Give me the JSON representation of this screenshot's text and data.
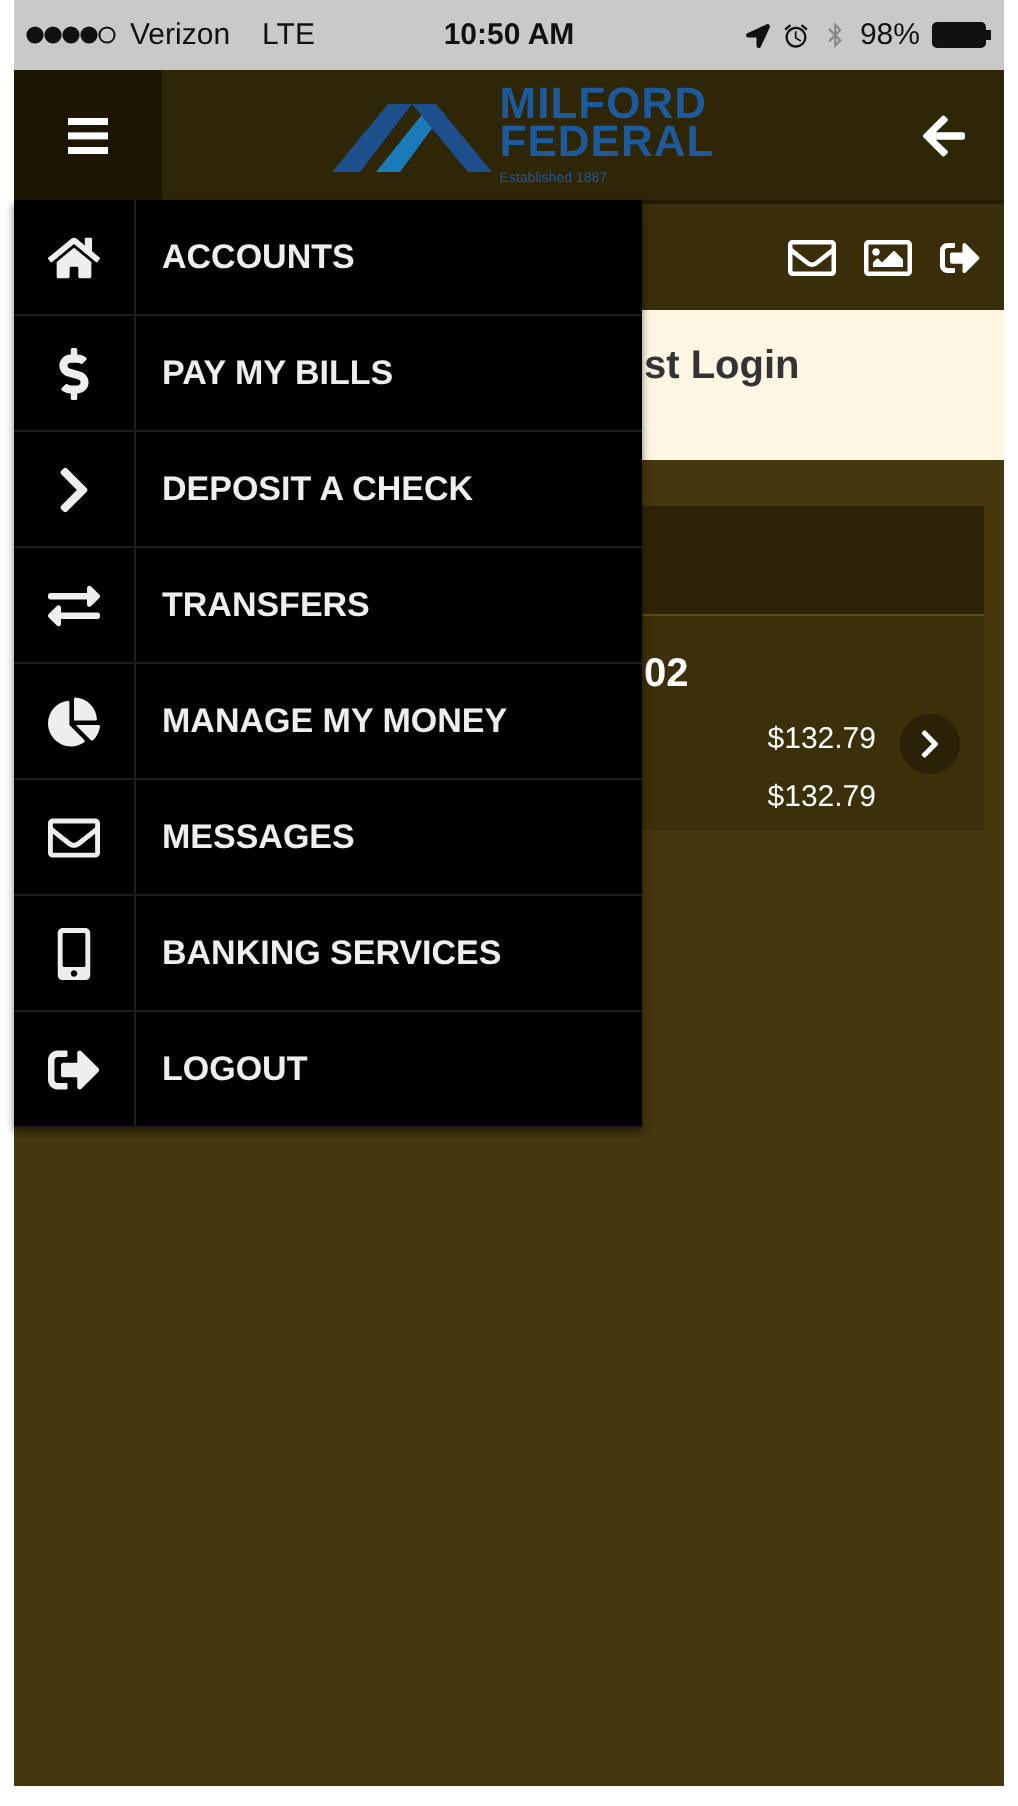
{
  "status_bar": {
    "carrier": "Verizon",
    "network": "LTE",
    "time": "10:50 AM",
    "battery": "98%"
  },
  "header": {
    "logo_line_1": "MILFORD",
    "logo_line_2": "FEDERAL",
    "logo_tagline": "Established 1887"
  },
  "welcome": {
    "text_visible": "st Login"
  },
  "account": {
    "name_visible": "02",
    "current_balance": "$132.79",
    "available_balance": "$132.79"
  },
  "menu": [
    {
      "label": "ACCOUNTS"
    },
    {
      "label": "PAY MY BILLS"
    },
    {
      "label": "DEPOSIT A CHECK"
    },
    {
      "label": "TRANSFERS"
    },
    {
      "label": "MANAGE MY MONEY"
    },
    {
      "label": "MESSAGES"
    },
    {
      "label": "BANKING SERVICES"
    },
    {
      "label": "LOGOUT"
    }
  ]
}
